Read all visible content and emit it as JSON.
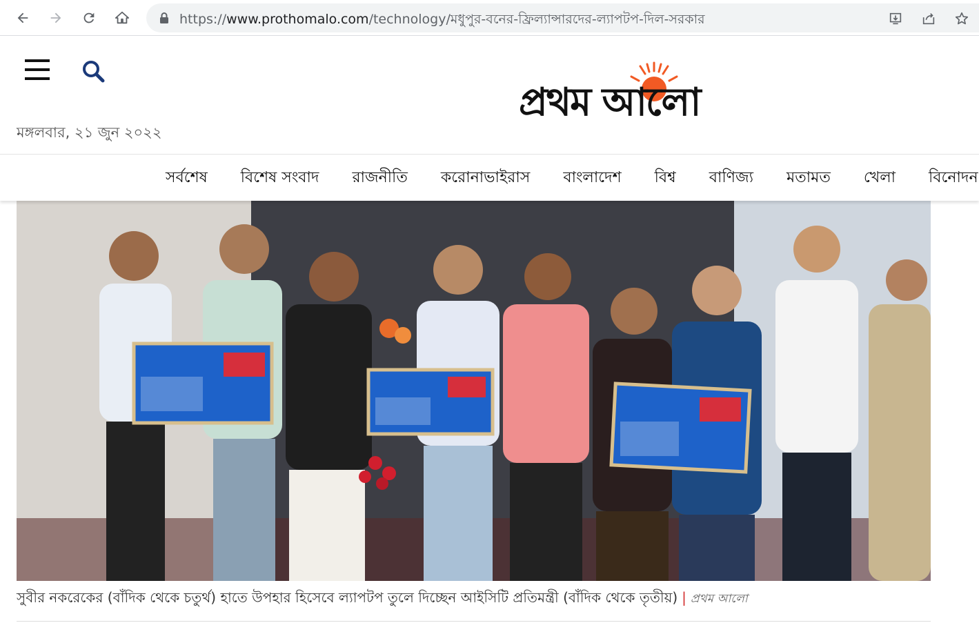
{
  "browser": {
    "url_prefix": "https://",
    "url_host": "www.prothomalo.com",
    "url_path": "/technology/মধুপুর-বনের-ফ্রিল্যান্সারদের-ল্যাপটপ-দিল-সরকার"
  },
  "header": {
    "date": "মঙ্গলবার, ২১ জুন ২০২২",
    "logo_text": "প্রথম আলো",
    "brand_color": "#f15a24"
  },
  "nav": {
    "items": [
      "সর্বশেষ",
      "বিশেষ সংবাদ",
      "রাজনীতি",
      "করোনাভাইরাস",
      "বাংলাদেশ",
      "বিশ্ব",
      "বাণিজ্য",
      "মতামত",
      "খেলা",
      "বিনোদন"
    ]
  },
  "article": {
    "caption": "সুবীর নকরেকের (বাঁদিক থেকে চতুর্থ) হাতে উপহার হিসেবে ল্যাপটপ তুলে দিচ্ছেন আইসিটি প্রতিমন্ত্রী (বাঁদিক থেকে তৃতীয়)",
    "caption_separator": "|",
    "credit": "প্রথম আলো"
  }
}
